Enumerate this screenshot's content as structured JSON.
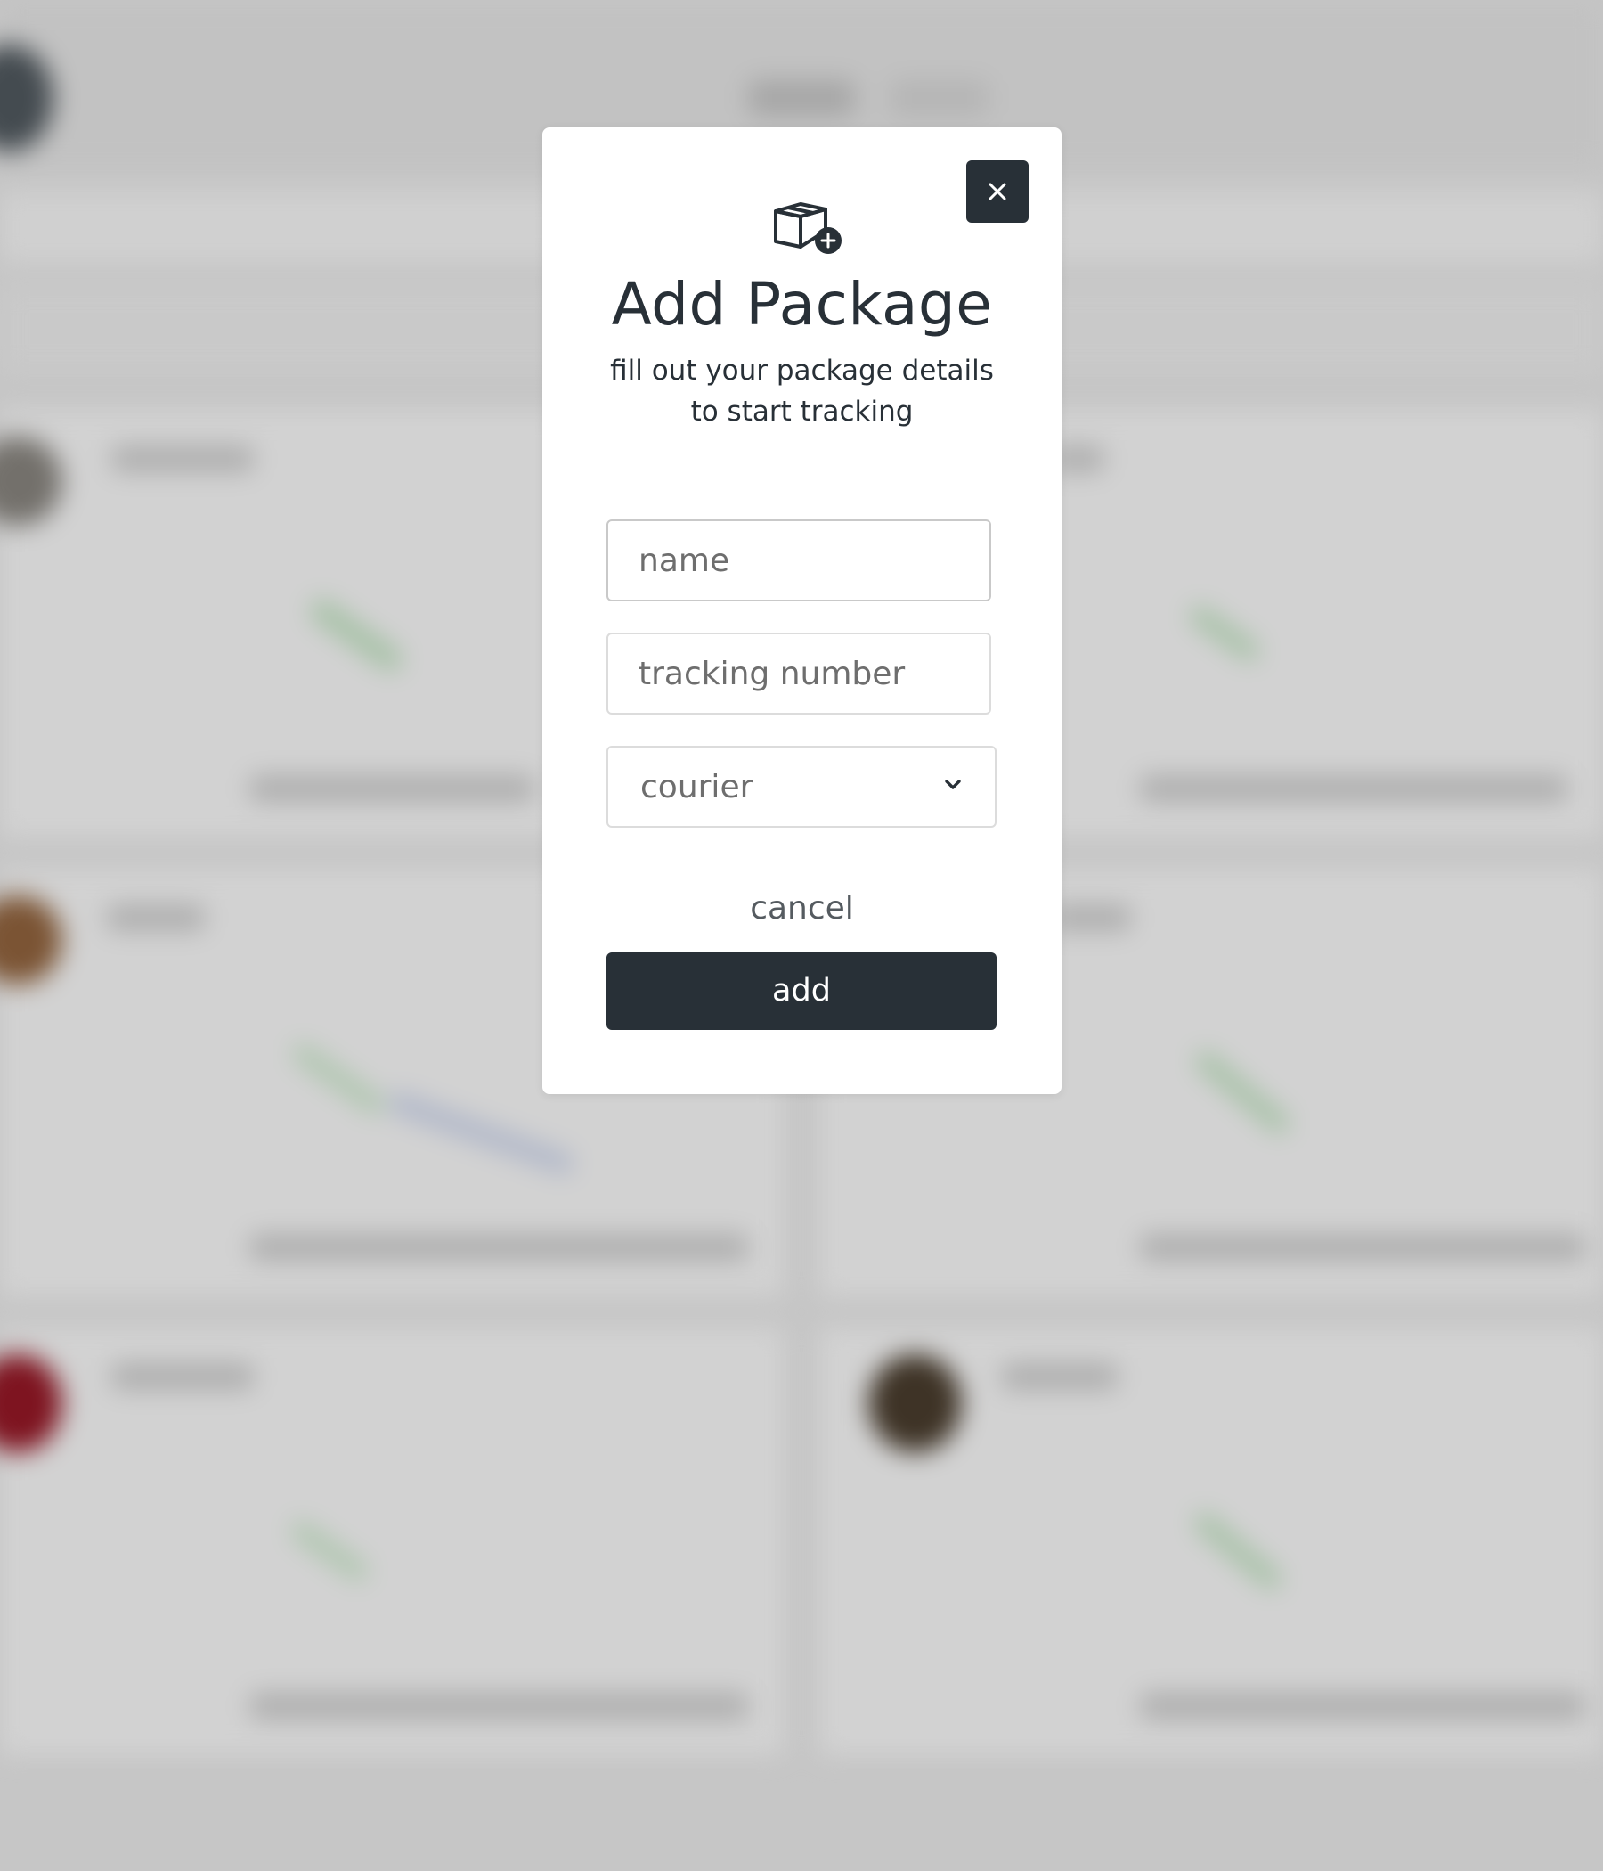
{
  "modal": {
    "title": "Add Package",
    "subtitle_line1": "fill out your package details",
    "subtitle_line2": "to start tracking",
    "name_placeholder": "name",
    "tracking_placeholder": "tracking number",
    "courier_label": "courier",
    "cancel_label": "cancel",
    "add_label": "add",
    "icons": {
      "close": "close-icon",
      "package": "package-add-icon",
      "chevron": "chevron-down-icon"
    }
  },
  "colors": {
    "accent_dark": "#283037",
    "backdrop": "#c6c6c6",
    "modal_bg": "#ffffff",
    "placeholder": "#6e6e6e"
  }
}
